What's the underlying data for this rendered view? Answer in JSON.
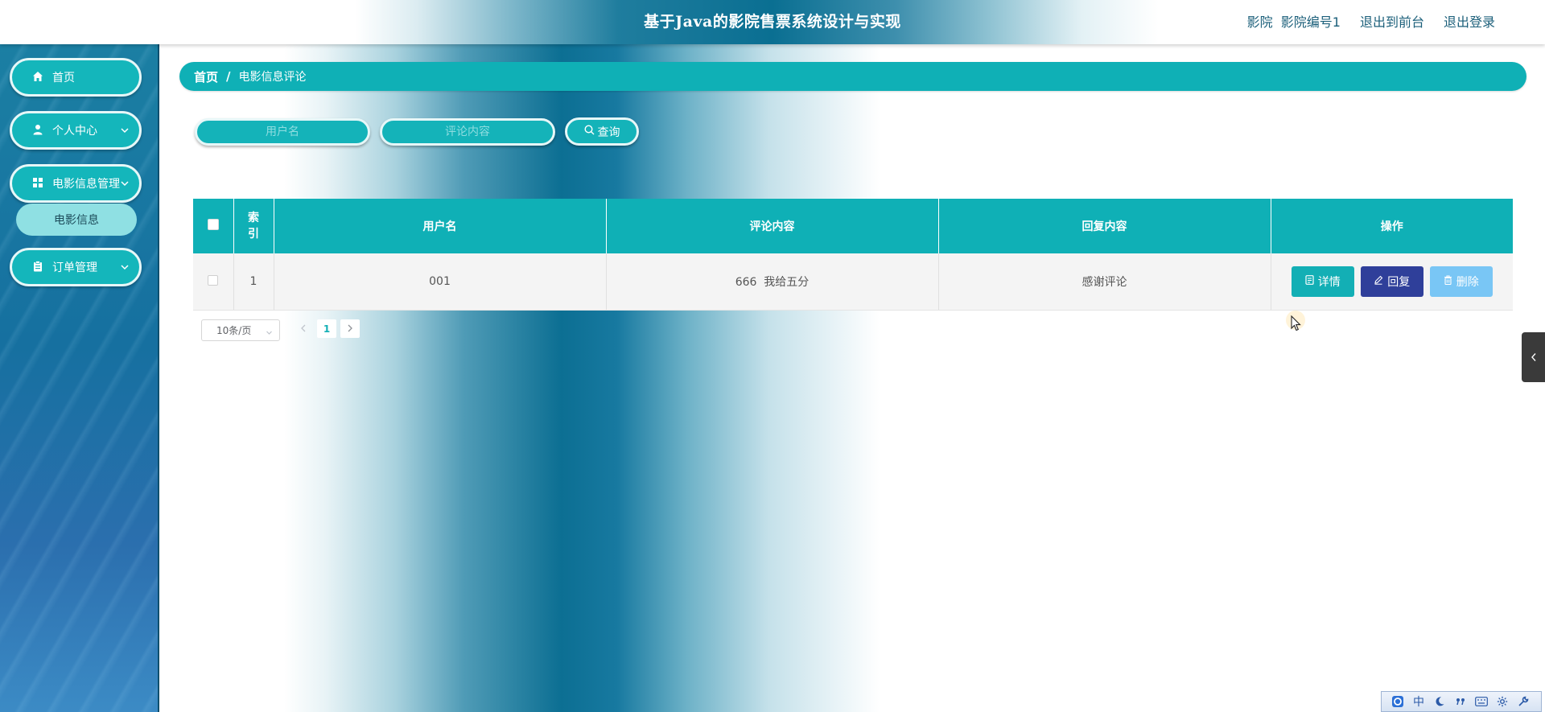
{
  "header": {
    "title": "基于Java的影院售票系统设计与实现",
    "user_role": "影院",
    "user_name": "影院编号1",
    "to_front_label": "退出到前台",
    "logout_label": "退出登录"
  },
  "sidebar": {
    "items": [
      {
        "label": "首页",
        "icon": "home-icon"
      },
      {
        "label": "个人中心",
        "icon": "user-icon"
      },
      {
        "label": "电影信息管理",
        "icon": "grid-icon",
        "expanded": true,
        "children": [
          {
            "label": "电影信息"
          }
        ]
      },
      {
        "label": "订单管理",
        "icon": "clipboard-icon"
      }
    ]
  },
  "breadcrumb": {
    "home": "首页",
    "separator": "/",
    "current": "电影信息评论"
  },
  "search": {
    "username_placeholder": "用户名",
    "content_placeholder": "评论内容",
    "button_label": "查询"
  },
  "table": {
    "headers": {
      "index": "索引",
      "username": "用户名",
      "content": "评论内容",
      "reply": "回复内容",
      "actions": "操作"
    },
    "rows": [
      {
        "index": "1",
        "username": "001",
        "content": "666  我给五分",
        "reply": "感谢评论"
      }
    ],
    "actions": {
      "detail": "详情",
      "reply": "回复",
      "delete": "删除"
    }
  },
  "pagination": {
    "page_size": "10条/页",
    "current_page": "1"
  },
  "ime": {
    "mode": "中"
  },
  "colors": {
    "primary_teal": "#0fb0b6",
    "reply_button": "#2f3f9a",
    "delete_button": "#79c6f5",
    "sidebar_bg": "#1670a0"
  }
}
